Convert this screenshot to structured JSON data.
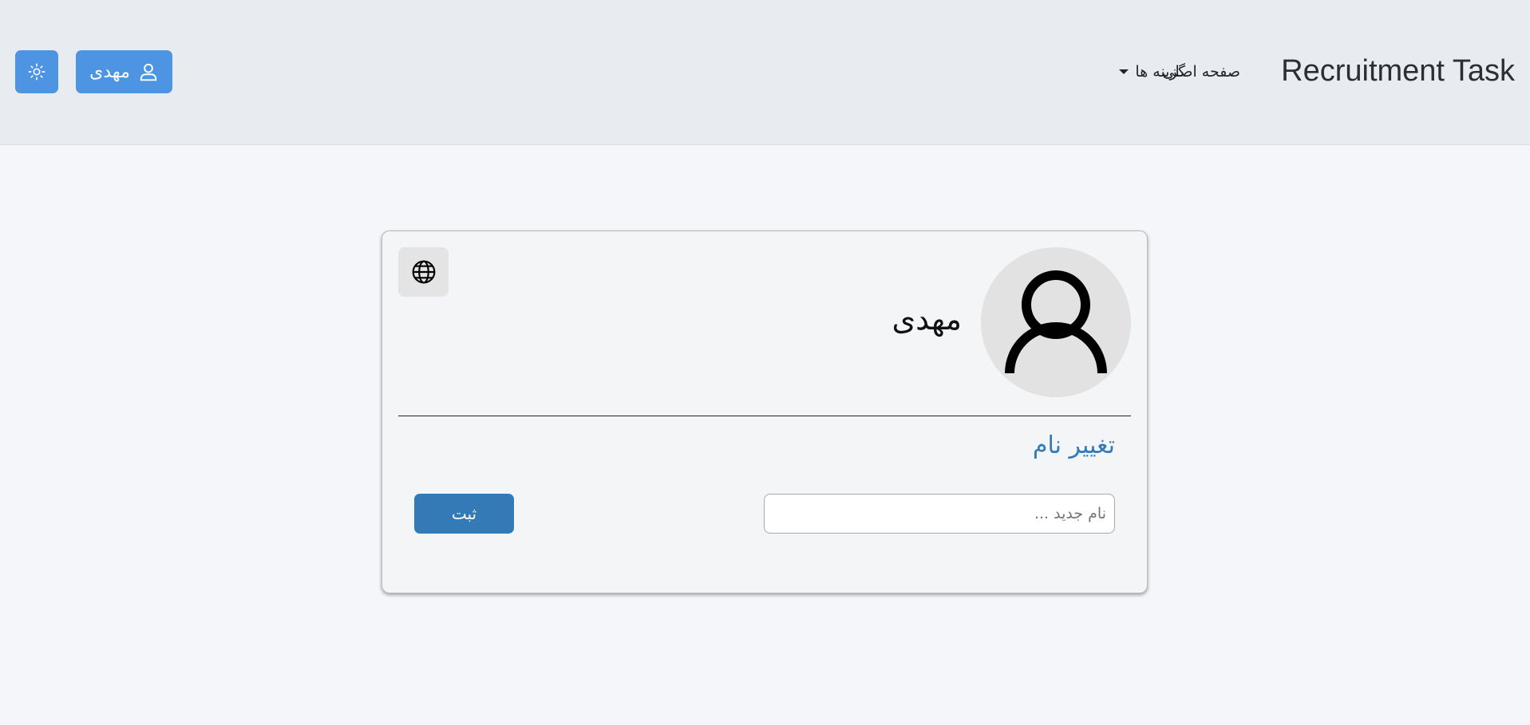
{
  "navbar": {
    "brand": "Recruitment Task",
    "home_link": "صفحه اصلی",
    "options_menu": "گزینه ها",
    "user_button_label": "مهدی",
    "icons": {
      "user": "user-icon",
      "theme_toggle": "sun-icon",
      "options_caret": "caret-down-icon"
    }
  },
  "profile_card": {
    "display_name": "مهدی",
    "avatar_icon": "user-avatar-icon",
    "language_icon": "globe-icon",
    "change_name": {
      "title": "تغییر نام",
      "input_placeholder": "نام جدید ...",
      "input_value": "",
      "submit_label": "ثبت"
    }
  },
  "colors": {
    "navbar_bg": "#e8ebef",
    "page_bg": "#f4f6f9",
    "primary_button": "#4d94e3",
    "submit_button": "#337ab7",
    "section_title": "#337ab7"
  }
}
